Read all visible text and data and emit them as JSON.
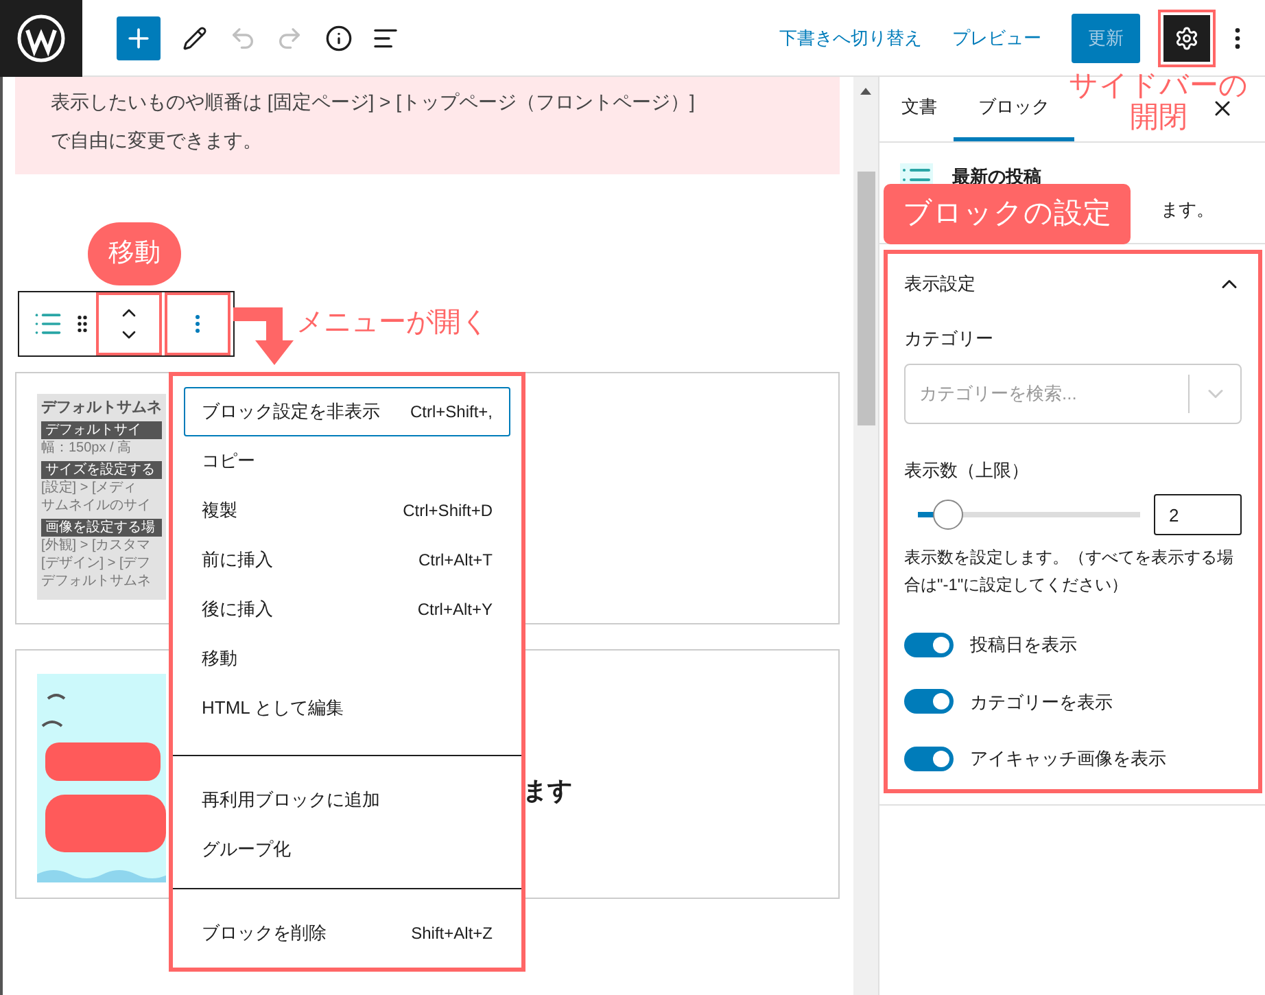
{
  "top_bar": {
    "history": [
      {
        "kind": "undo",
        "disabled": true
      },
      {
        "kind": "redo",
        "disabled": true
      }
    ],
    "actions": [
      {
        "label": "下書きへ切り替え"
      },
      {
        "label": "プレビュー"
      }
    ],
    "update_button": {
      "label": "更新",
      "disabled": true
    },
    "settings_button": {
      "selected": true
    }
  },
  "notice": {
    "lines": [
      "表示したいものや順番は [固定ページ] > [トップページ（フロントページ）]",
      "で自由に変更できます。"
    ]
  },
  "thumbnail_block": {
    "lines": [
      {
        "kind": "title",
        "text": "デフォルトサムネ"
      },
      {
        "kind": "label",
        "text": "デフォルトサイ"
      },
      {
        "kind": "text",
        "text": "幅：150px / 高"
      },
      {
        "kind": "label",
        "text": "サイズを設定する"
      },
      {
        "kind": "text",
        "text": "[設定] > [メディ"
      },
      {
        "kind": "text",
        "text": "サムネイルのサイ"
      },
      {
        "kind": "label",
        "text": "画像を設定する場"
      },
      {
        "kind": "text",
        "text": "[外観] > [カスタマ"
      },
      {
        "kind": "text",
        "text": "[デザイン] > [デフ"
      },
      {
        "kind": "text",
        "text": "デフォルトサムネ"
      }
    ]
  },
  "sale_block": {
    "title_tail": "ます"
  },
  "block_menu": {
    "groups": [
      [
        {
          "label": "ブロック設定を非表示",
          "shortcut": "Ctrl+Shift+,",
          "focused": true
        },
        {
          "label": "コピー",
          "focused": false
        },
        {
          "label": "複製",
          "shortcut": "Ctrl+Shift+D",
          "focused": false
        },
        {
          "label": "前に挿入",
          "shortcut": "Ctrl+Alt+T",
          "focused": false
        },
        {
          "label": "後に挿入",
          "shortcut": "Ctrl+Alt+Y",
          "focused": false
        },
        {
          "label": "移動",
          "focused": false
        },
        {
          "label": "HTML として編集",
          "focused": false
        }
      ],
      [
        {
          "label": "再利用ブロックに追加",
          "focused": false
        },
        {
          "label": "グループ化",
          "focused": false
        }
      ],
      [
        {
          "label": "ブロックを削除",
          "shortcut": "Shift+Alt+Z",
          "focused": false
        }
      ]
    ]
  },
  "sidebar": {
    "tabs": [
      {
        "label": "文書",
        "selected": false
      },
      {
        "label": "ブロック",
        "selected": true
      }
    ],
    "block_card": {
      "title": "最新の投稿",
      "description_tail": "ます。"
    },
    "panel": {
      "title": "表示設定",
      "expanded": true,
      "category": {
        "label": "カテゴリー",
        "placeholder": "カテゴリーを検索..."
      },
      "count": {
        "label": "表示数（上限）",
        "level": 0.1,
        "value": "2",
        "help": "表示数を設定します。（すべてを表示する場合は\"-1\"に設定してください）"
      },
      "toggles": [
        {
          "label": "投稿日を表示",
          "on": true
        },
        {
          "label": "カテゴリーを表示",
          "on": true
        },
        {
          "label": "アイキャッチ画像を表示",
          "on": true
        }
      ]
    }
  },
  "annotations": {
    "move": "移動",
    "menu_opens": "メニューが開く",
    "sidebar_toggle": [
      "サイドバーの",
      "開閉"
    ],
    "block_settings": "ブロックの設定"
  }
}
